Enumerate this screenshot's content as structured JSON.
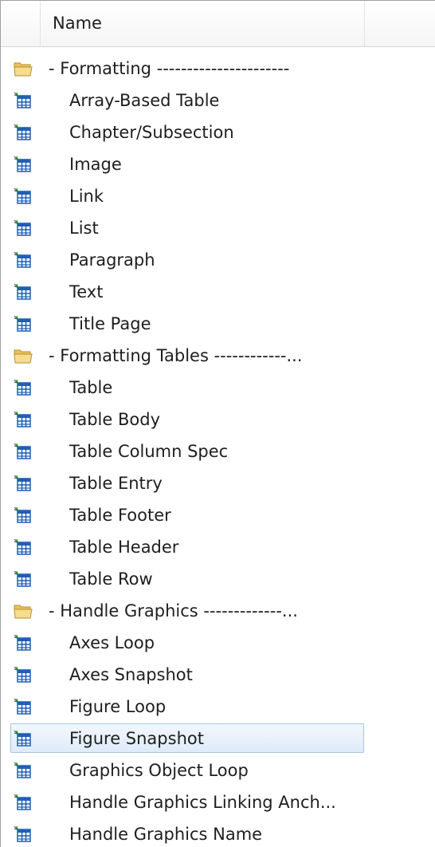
{
  "header": {
    "name_column": "Name"
  },
  "rows": [
    {
      "type": "folder",
      "label": "-  Formatting  ----------------------",
      "icon": "folder-icon"
    },
    {
      "type": "item",
      "label": "Array-Based Table",
      "icon": "table-component-icon"
    },
    {
      "type": "item",
      "label": "Chapter/Subsection",
      "icon": "table-component-icon"
    },
    {
      "type": "item",
      "label": "Image",
      "icon": "table-component-icon"
    },
    {
      "type": "item",
      "label": "Link",
      "icon": "table-component-icon"
    },
    {
      "type": "item",
      "label": "List",
      "icon": "table-component-icon"
    },
    {
      "type": "item",
      "label": "Paragraph",
      "icon": "table-component-icon"
    },
    {
      "type": "item",
      "label": "Text",
      "icon": "table-component-icon"
    },
    {
      "type": "item",
      "label": "Title Page",
      "icon": "table-component-icon"
    },
    {
      "type": "folder",
      "label": "-  Formatting Tables  ------------...",
      "icon": "folder-icon"
    },
    {
      "type": "item",
      "label": "Table",
      "icon": "table-component-icon"
    },
    {
      "type": "item",
      "label": "Table Body",
      "icon": "table-component-icon"
    },
    {
      "type": "item",
      "label": "Table Column Spec",
      "icon": "table-component-icon"
    },
    {
      "type": "item",
      "label": "Table Entry",
      "icon": "table-component-icon"
    },
    {
      "type": "item",
      "label": "Table Footer",
      "icon": "table-component-icon"
    },
    {
      "type": "item",
      "label": "Table Header",
      "icon": "table-component-icon"
    },
    {
      "type": "item",
      "label": "Table Row",
      "icon": "table-component-icon"
    },
    {
      "type": "folder",
      "label": "-  Handle Graphics  -------------...",
      "icon": "folder-icon"
    },
    {
      "type": "item",
      "label": "Axes Loop",
      "icon": "table-component-icon"
    },
    {
      "type": "item",
      "label": "Axes Snapshot",
      "icon": "table-component-icon"
    },
    {
      "type": "item",
      "label": "Figure Loop",
      "icon": "table-component-icon"
    },
    {
      "type": "item",
      "label": "Figure Snapshot",
      "icon": "table-component-icon",
      "selected": true
    },
    {
      "type": "item",
      "label": "Graphics Object Loop",
      "icon": "table-component-icon"
    },
    {
      "type": "item",
      "label": "Handle Graphics Linking Anch...",
      "icon": "table-component-icon"
    },
    {
      "type": "item",
      "label": "Handle Graphics Name",
      "icon": "table-component-icon"
    }
  ],
  "colors": {
    "selection_border": "#a7c4e6",
    "selection_fill": "#dfebfa",
    "folder": "#f0d27a",
    "table_icon": "#1f5fb8"
  }
}
